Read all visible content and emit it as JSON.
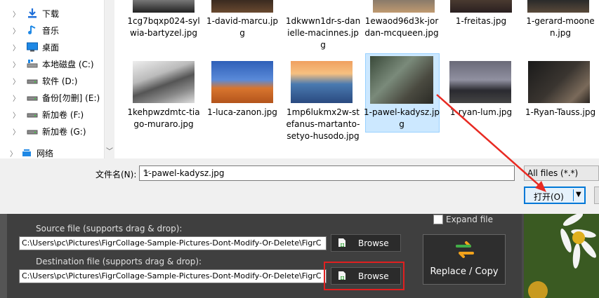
{
  "nav": {
    "items": [
      {
        "label": "下载",
        "icon": "download-icon"
      },
      {
        "label": "音乐",
        "icon": "music-icon"
      },
      {
        "label": "桌面",
        "icon": "desktop-icon"
      },
      {
        "label": "本地磁盘 (C:)",
        "icon": "drive-icon"
      },
      {
        "label": "软件 (D:)",
        "icon": "drive-icon"
      },
      {
        "label": "备份[勿删] (E:)",
        "icon": "drive-icon"
      },
      {
        "label": "新加卷 (F:)",
        "icon": "drive-icon"
      },
      {
        "label": "新加卷 (G:)",
        "icon": "drive-icon"
      },
      {
        "label": "网络",
        "icon": "network-icon"
      }
    ]
  },
  "files": {
    "row1": [
      {
        "name": "1cg7bqxp024-sylwia-bartyzel.jpg"
      },
      {
        "name": "1-david-marcu.jpg"
      },
      {
        "name": "1dkwwn1dr-s-danielle-macinnes.jpg"
      },
      {
        "name": "1ewaod96d3k-jordan-mcqueen.jpg"
      },
      {
        "name": "1-freitas.jpg"
      },
      {
        "name": "1-gerard-moonen.jpg"
      }
    ],
    "row2": [
      {
        "name": "1kehpwzdmtc-tiago-muraro.jpg"
      },
      {
        "name": "1-luca-zanon.jpg"
      },
      {
        "name": "1mp6lukmx2w-stefanus-martanto-setyo-husodo.jpg"
      },
      {
        "name": "1-pawel-kadysz.jpg"
      },
      {
        "name": "1-ryan-lum.jpg"
      },
      {
        "name": "1-Ryan-Tauss.jpg"
      }
    ]
  },
  "footer": {
    "filename_label": "文件名(N):",
    "filename_value": "1-pawel-kadysz.jpg",
    "filter": "All files (*.*)",
    "open_label": "打开(O)"
  },
  "app": {
    "expand_label": "Expand file",
    "source_label": "Source file (supports drag & drop):",
    "source_path": "C:\\Users\\pc\\Pictures\\FigrCollage-Sample-Pictures-Dont-Modify-Or-Delete\\FigrC",
    "dest_label": "Destination file (supports drag & drop):",
    "dest_path": "C:\\Users\\pc\\Pictures\\FigrCollage-Sample-Pictures-Dont-Modify-Or-Delete\\FigrC",
    "browse_label": "Browse",
    "replace_label": "Replace / Copy"
  },
  "colors": {
    "selection": "#cce8ff",
    "accent": "#0078d7",
    "highlight_red": "#e02020"
  }
}
